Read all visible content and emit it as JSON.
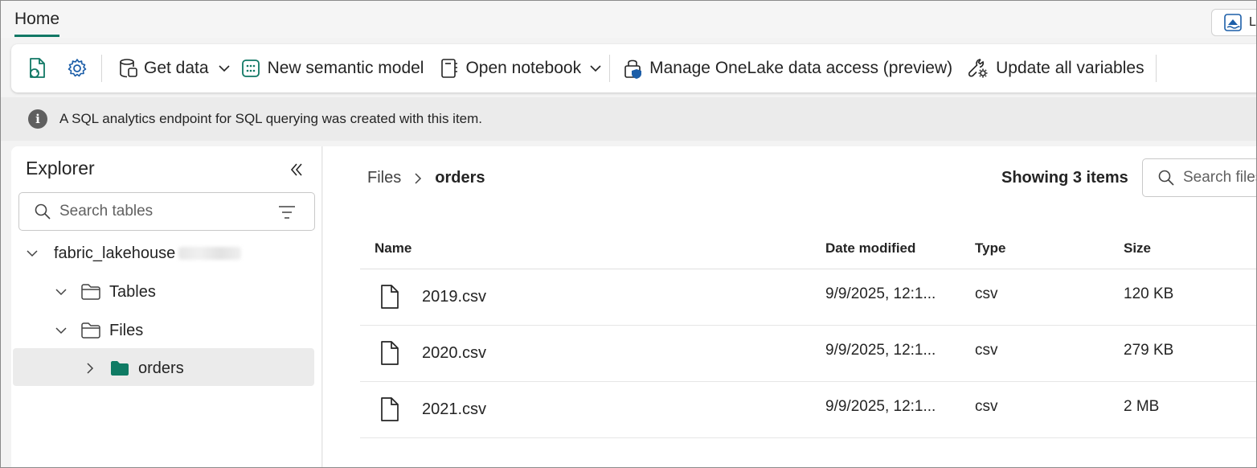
{
  "tabbar": {
    "home_tab": "Home",
    "right_button_label": "L"
  },
  "ribbon": {
    "get_data": "Get data",
    "new_semantic_model": "New semantic model",
    "open_notebook": "Open notebook",
    "manage_onelake": "Manage OneLake data access (preview)",
    "update_variables": "Update all variables"
  },
  "infobar": {
    "text": "A SQL analytics endpoint for SQL querying was created with this item."
  },
  "explorer": {
    "title": "Explorer",
    "search_placeholder": "Search tables",
    "tree": {
      "root": "fabric_lakehouse",
      "tables": "Tables",
      "files": "Files",
      "orders": "orders"
    }
  },
  "main": {
    "breadcrumb": [
      "Files",
      "orders"
    ],
    "count": "Showing 3 items",
    "search_placeholder": "Search files",
    "columns": [
      "Name",
      "Date modified",
      "Type",
      "Size"
    ],
    "rows": [
      {
        "name": "2019.csv",
        "date": "9/9/2025, 12:1...",
        "type": "csv",
        "size": "120 KB"
      },
      {
        "name": "2020.csv",
        "date": "9/9/2025, 12:1...",
        "type": "csv",
        "size": "279 KB"
      },
      {
        "name": "2021.csv",
        "date": "9/9/2025, 12:1...",
        "type": "csv",
        "size": "2 MB"
      }
    ]
  },
  "colors": {
    "accent": "#117865",
    "folder_green": "#0f7b64",
    "nav_blue": "#1c5ea8"
  }
}
